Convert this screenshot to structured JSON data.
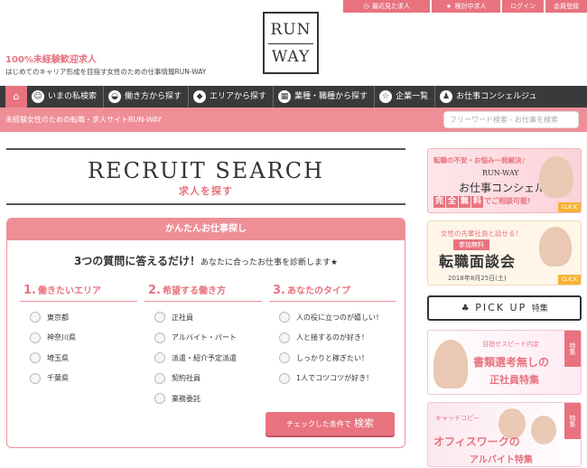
{
  "colors": {
    "accent": "#e8737f",
    "nav": "#3a3a3a",
    "pink_light": "#ee8f97"
  },
  "utility": [
    {
      "label": "最近見た求人",
      "icon": "clock-icon"
    },
    {
      "label": "検討中求人",
      "icon": "star-icon"
    },
    {
      "label": "ログイン"
    },
    {
      "label": "会員登録"
    }
  ],
  "logo": {
    "line1": "RUN",
    "line2": "WAY"
  },
  "tagline": {
    "headline": "100%未経験歓迎求人",
    "sub": "はじめてのキャリア形成を目指す女性のための仕事情報RUN-WAY"
  },
  "nav": {
    "home_icon": "home-icon",
    "items": [
      {
        "label": "いまの私検索",
        "icon": "person-search-icon"
      },
      {
        "label": "働き方から探す",
        "icon": "bag-icon"
      },
      {
        "label": "エリアから探す",
        "icon": "tag-icon"
      },
      {
        "label": "業種・職種から探す",
        "icon": "building-icon"
      },
      {
        "label": "企業一覧",
        "icon": "star-icon"
      },
      {
        "label": "お仕事コンシェルジュ",
        "icon": "concierge-icon"
      }
    ]
  },
  "subbar": {
    "text": "未経験女性のための転職・求人サイトRUN-WAY",
    "search_placeholder": "フリーワード検索 - お仕事を検索"
  },
  "recruit": {
    "title": "RECRUIT SEARCH",
    "subtitle": "求人を探す"
  },
  "panel": {
    "heading": "かんたんお仕事探し",
    "lead_big": "3つの質問に答えるだけ！",
    "lead_small": "あなたに合ったお仕事を診断します★",
    "columns": [
      {
        "num": "1.",
        "title": "働きたいエリア",
        "options": [
          "東京都",
          "神奈川県",
          "埼玉県",
          "千葉県"
        ]
      },
      {
        "num": "2.",
        "title": "希望する働き方",
        "options": [
          "正社員",
          "アルバイト・パート",
          "派遣・紹介予定派遣",
          "契約社員",
          "業務委託"
        ]
      },
      {
        "num": "3.",
        "title": "あなたのタイプ",
        "options": [
          "人の役に立つのが嬉しい！",
          "人と接するのが好き！",
          "しっかりと稼ぎたい！",
          "1人でコツコツが好き！"
        ]
      }
    ],
    "submit_small": "チェックした条件で",
    "submit_big": "検索"
  },
  "banners": {
    "concierge": {
      "t1": "転職の不安・お悩み一発解決♪",
      "t2": "RUN-WAY",
      "t3": "お仕事コンシェルジュ",
      "t4_boxes": [
        "完",
        "全",
        "無",
        "料"
      ],
      "t4_rest": "でご相談可能!",
      "click": "CLICK"
    },
    "interview": {
      "t1": "女性の先輩社員と話せる！",
      "tag": "参加無料",
      "t2": "転職面談会",
      "t3": "2018年8月25日(土)",
      "click": "CLICK"
    },
    "pickup": {
      "label": "PICK UP",
      "suffix": "特集"
    },
    "speed": {
      "t1": "目指せスピード内定",
      "t2": "書類選考無しの",
      "t3": "正社員特集",
      "corner": "特集"
    },
    "office": {
      "t1": "キャッチコピー",
      "t2": "オフィスワークの",
      "t3": "アルバイト特集",
      "corner": "特集"
    }
  }
}
